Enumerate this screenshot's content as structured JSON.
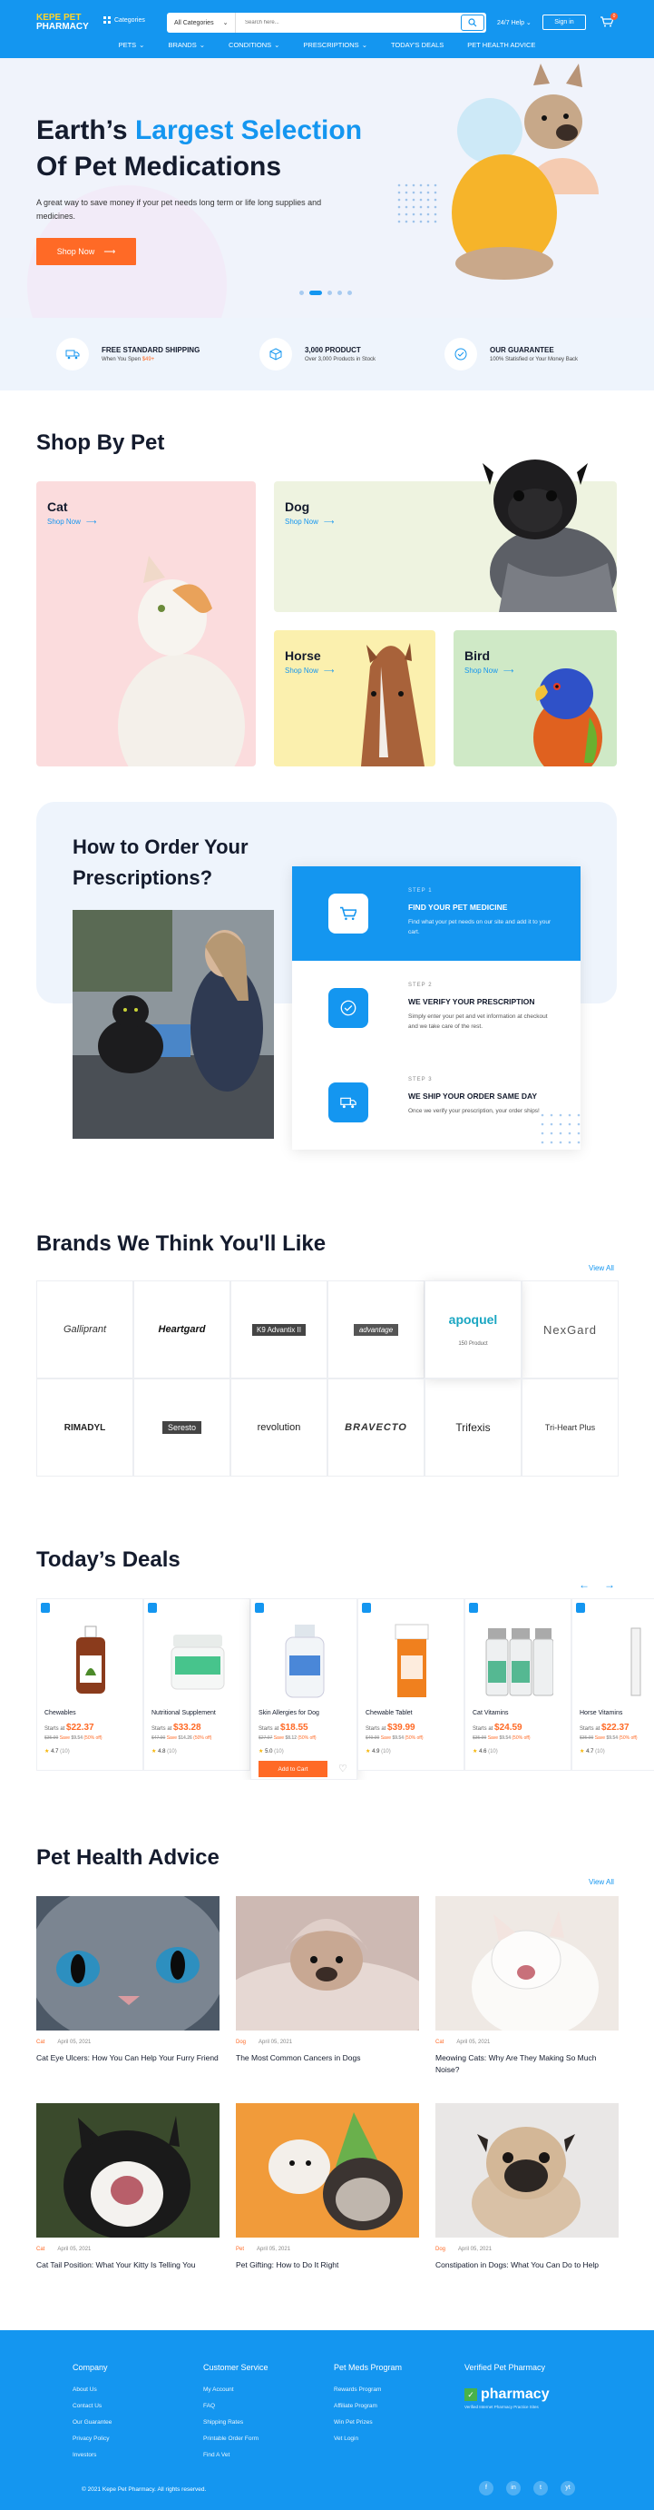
{
  "header": {
    "logo_line1": "KEPE PET",
    "logo_line2": "PHARMACY",
    "categories_label": "Categories",
    "search_category": "All Categories",
    "search_placeholder": "Search here...",
    "help_label": "24/7 Help",
    "signin_label": "Sign in",
    "cart_count": "0"
  },
  "nav": [
    "PETS",
    "BRANDS",
    "CONDITIONS",
    "PRESCRIPTIONS",
    "TODAY'S DEALS",
    "PET HEALTH ADVICE"
  ],
  "hero": {
    "title_a": "Earth’s ",
    "title_highlight": "Largest Selection",
    "title_b": "Of Pet Medications",
    "subtitle": "A great way to save money if your pet needs long term or life long supplies and medicines.",
    "cta": "Shop Now"
  },
  "features": [
    {
      "title": "FREE STANDARD SHIPPING",
      "sub": "When You Spen ",
      "sub_highlight": "$49+"
    },
    {
      "title": "3,000 PRODUCT",
      "sub": "Over 3,000 Products in Stock",
      "sub_highlight": ""
    },
    {
      "title": "OUR GUARANTEE",
      "sub": "100% Statisfied or Your Money Back",
      "sub_highlight": ""
    }
  ],
  "shop_by_pet": {
    "title": "Shop By Pet",
    "shop_now": "Shop Now",
    "pets": [
      "Cat",
      "Dog",
      "Horse",
      "Bird"
    ]
  },
  "order": {
    "title_line1": "How to Order Your",
    "title_line2": "Prescriptions?",
    "steps": [
      {
        "num": "STEP 1",
        "title": "FIND YOUR PET MEDICINE",
        "desc": "Find what your pet needs on our site and add it to your cart."
      },
      {
        "num": "STEP 2",
        "title": "WE VERIFY YOUR PRESCRIPTION",
        "desc": "Simply enter your pet and vet information at checkout and we take care of the rest."
      },
      {
        "num": "STEP 3",
        "title": "WE SHIP YOUR ORDER SAME DAY",
        "desc": "Once we verify your prescription, your order ships!"
      }
    ]
  },
  "brands": {
    "title": "Brands We Think You'll Like",
    "view_all": "View All",
    "items": [
      "Galliprant",
      "Heartgard",
      "K9 Advantix II",
      "advantage",
      "apoquel",
      "NexGard",
      "RIMADYL",
      "Seresto",
      "revolution",
      "BRAVECTO",
      "Trifexis",
      "Tri-Heart Plus"
    ],
    "product_count": "150 Product"
  },
  "deals": {
    "title": "Today’s Deals",
    "starts_at": "Starts at",
    "save_label": "Save",
    "add_to_cart": "Add to Cart",
    "items": [
      {
        "name": "Chewables",
        "price": "$22.37",
        "old": "$35.99",
        "save": "$9.54",
        "off": "(50% off)",
        "rating": "4.7",
        "reviews": "(10)"
      },
      {
        "name": "Nutritional Supplement",
        "price": "$33.28",
        "old": "$47.90",
        "save": "$14.26",
        "off": "(50% off)",
        "rating": "4.8",
        "reviews": "(10)"
      },
      {
        "name": "Skin Allergies for Dog",
        "price": "$18.55",
        "old": "$27.97",
        "save": "$8.12",
        "off": "(50% off)",
        "rating": "5.0",
        "reviews": "(10)"
      },
      {
        "name": "Chewable Tablet",
        "price": "$39.99",
        "old": "$49.99",
        "save": "$9.54",
        "off": "(50% off)",
        "rating": "4.9",
        "reviews": "(10)"
      },
      {
        "name": "Cat Vitamins",
        "price": "$24.59",
        "old": "$35.99",
        "save": "$9.54",
        "off": "(50% off)",
        "rating": "4.6",
        "reviews": "(10)"
      },
      {
        "name": "Horse Vitamins",
        "price": "$22.37",
        "old": "$35.99",
        "save": "$9.54",
        "off": "(50% off)",
        "rating": "4.7",
        "reviews": "(10)"
      }
    ]
  },
  "advice": {
    "title": "Pet Health Advice",
    "view_all": "View All",
    "articles": [
      {
        "cat": "Cat",
        "date": "April 05, 2021",
        "title": "Cat Eye Ulcers: How You Can Help Your Furry Friend"
      },
      {
        "cat": "Dog",
        "date": "April 05, 2021",
        "title": "The Most Common Cancers in Dogs"
      },
      {
        "cat": "Cat",
        "date": "April 05, 2021",
        "title": "Meowing Cats: Why Are They Making So Much Noise?"
      },
      {
        "cat": "Cat",
        "date": "April 05, 2021",
        "title": "Cat Tail Position: What Your Kitty Is Telling You"
      },
      {
        "cat": "Pet",
        "date": "April 05, 2021",
        "title": "Pet Gifting: How to Do It Right"
      },
      {
        "cat": "Dog",
        "date": "April 05, 2021",
        "title": "Constipation in Dogs: What You Can Do to Help"
      }
    ]
  },
  "footer": {
    "cols": [
      {
        "title": "Company",
        "links": [
          "About Us",
          "Contact Us",
          "Our Guarantee",
          "Privacy Policy",
          "Investors"
        ]
      },
      {
        "title": "Customer Service",
        "links": [
          "My Account",
          "FAQ",
          "Shipping Rates",
          "Printable Order Form",
          "Find A Vet"
        ]
      },
      {
        "title": "Pet Meds Program",
        "links": [
          "Rewards Program",
          "Affiliate Program",
          "Win Pet Prizes",
          "Vet Login"
        ]
      },
      {
        "title": "Verified Pet Pharmacy",
        "links": []
      }
    ],
    "vipps": "pharmacy",
    "vipps_sub": "Verified Internet Pharmacy Practice Sites",
    "copyright": "© 2021 Kepe Pet Pharmacy. All rights reserved.",
    "social": [
      "f",
      "in",
      "t",
      "yt"
    ]
  },
  "colors": {
    "primary": "#1496f0",
    "accent": "#ff6a26",
    "dark": "#141b2d"
  }
}
